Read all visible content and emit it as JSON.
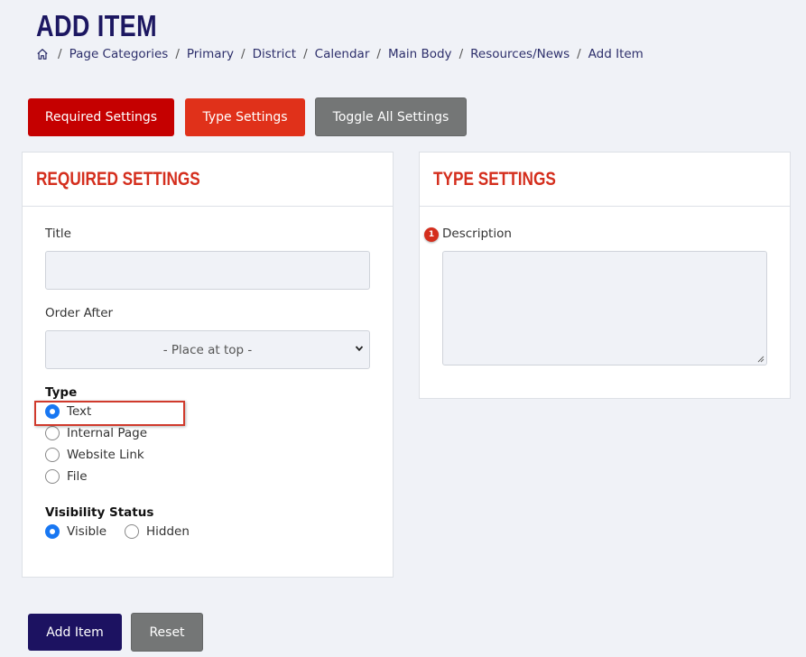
{
  "page": {
    "title": "ADD ITEM"
  },
  "breadcrumb": {
    "home_icon": "home-icon",
    "items": [
      "Page Categories",
      "Primary",
      "District",
      "Calendar",
      "Main Body",
      "Resources/News",
      "Add Item"
    ]
  },
  "toolbar": {
    "required_settings_label": "Required Settings",
    "type_settings_label": "Type Settings",
    "toggle_all_label": "Toggle All Settings"
  },
  "required_settings": {
    "heading": "REQUIRED SETTINGS",
    "title_label": "Title",
    "title_value": "",
    "order_after_label": "Order After",
    "order_after_value": "- Place at top -",
    "type_label": "Type",
    "type_options": [
      "Text",
      "Internal Page",
      "Website Link",
      "File"
    ],
    "type_selected": "Text",
    "visibility_label": "Visibility Status",
    "visibility_options": [
      "Visible",
      "Hidden"
    ],
    "visibility_selected": "Visible"
  },
  "type_settings": {
    "heading": "TYPE SETTINGS",
    "description_label": "Description",
    "description_value": "",
    "annotation_badge": "1"
  },
  "footer": {
    "add_item_label": "Add Item",
    "reset_label": "Reset"
  },
  "colors": {
    "primary_navy": "#1c1261",
    "accent_red": "#c50000",
    "type_orange_red": "#e0311a",
    "heading_red": "#d42e1d",
    "gray_button": "#747676",
    "radio_blue": "#1877f2",
    "background": "#f0f2f7"
  }
}
